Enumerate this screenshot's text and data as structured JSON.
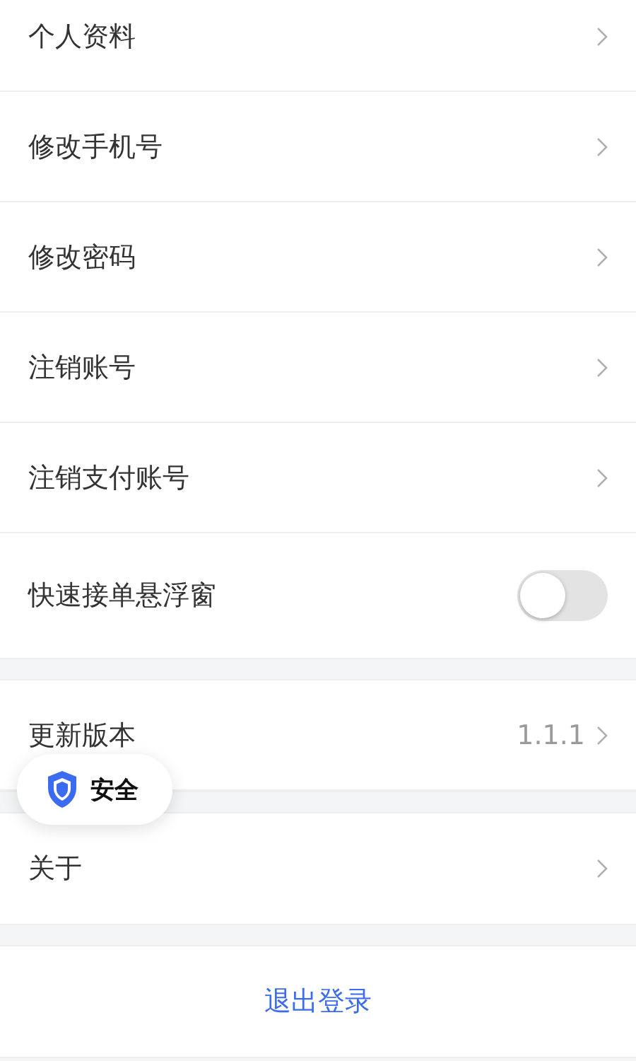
{
  "sections": [
    {
      "items": [
        {
          "kind": "link",
          "label": "个人资料"
        },
        {
          "kind": "link",
          "label": "修改手机号"
        },
        {
          "kind": "link",
          "label": "修改密码"
        },
        {
          "kind": "link",
          "label": "注销账号"
        },
        {
          "kind": "link",
          "label": "注销支付账号"
        },
        {
          "kind": "toggle",
          "label": "快速接单悬浮窗",
          "on": false
        }
      ]
    },
    {
      "items": [
        {
          "kind": "link",
          "label": "更新版本",
          "value": "1.1.1"
        }
      ]
    },
    {
      "items": [
        {
          "kind": "link",
          "label": "关于"
        }
      ]
    }
  ],
  "logout": {
    "label": "退出登录"
  },
  "floating_badge": {
    "label": "安全"
  }
}
